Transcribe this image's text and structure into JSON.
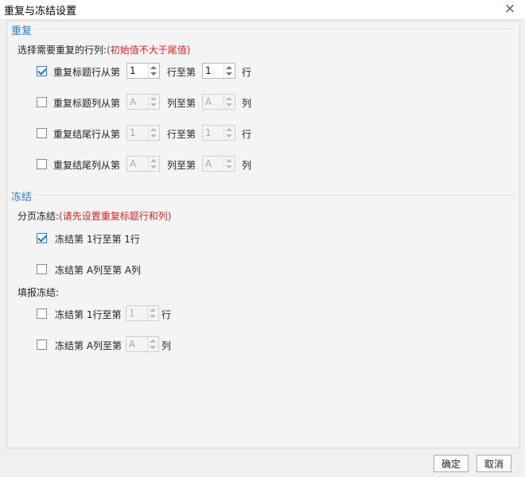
{
  "window": {
    "title": "重复与冻结设置",
    "close_icon": "×"
  },
  "repeat": {
    "section_title": "重复",
    "prompt": "选择需要重复的行列:",
    "hint": "(初始值不大于尾值)",
    "rows": [
      {
        "checked": true,
        "label": "重复标题行从第",
        "from": "1",
        "mid": "行至第",
        "to": "1",
        "unit": "行",
        "enabled": true
      },
      {
        "checked": false,
        "label": "重复标题列从第",
        "from": "A",
        "mid": "列至第",
        "to": "A",
        "unit": "列",
        "enabled": false
      },
      {
        "checked": false,
        "label": "重复结尾行从第",
        "from": "1",
        "mid": "行至第",
        "to": "1",
        "unit": "行",
        "enabled": false
      },
      {
        "checked": false,
        "label": "重复结尾列从第",
        "from": "A",
        "mid": "列至第",
        "to": "A",
        "unit": "列",
        "enabled": false
      }
    ]
  },
  "freeze": {
    "section_title": "冻结",
    "page_freeze_label": "分页冻结:",
    "page_freeze_hint": "(请先设置重复标题行和列)",
    "page_rows": [
      {
        "checked": true,
        "text": "冻结第 1行至第 1行"
      },
      {
        "checked": false,
        "text": "冻结第 A列至第 A列"
      }
    ],
    "fill_freeze_label": "填报冻结:",
    "fill_rows": [
      {
        "checked": false,
        "label": "冻结第 1行至第",
        "value": "1",
        "unit": "行"
      },
      {
        "checked": false,
        "label": "冻结第 A列至第",
        "value": "A",
        "unit": "列"
      }
    ]
  },
  "buttons": {
    "ok": "确定",
    "cancel": "取消"
  }
}
